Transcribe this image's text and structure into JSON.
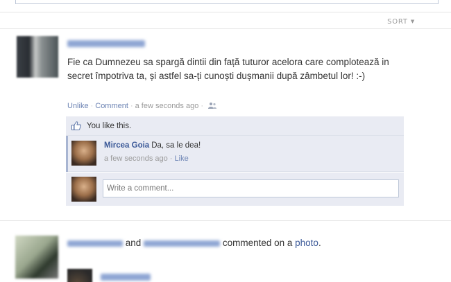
{
  "sort": {
    "label": "SORT"
  },
  "post": {
    "text": "Fie ca Dumnezeu sa spargă dintii din față tuturor acelora care complotează in secret împotriva ta, și astfel sa-ți cunoști dușmanii după zâmbetul lor! :-)",
    "actions": {
      "unlike": "Unlike",
      "comment": "Comment",
      "timestamp": "a few seconds ago"
    },
    "likes": {
      "text": "You like this."
    },
    "comments": [
      {
        "author": "Mircea Goia",
        "text": "Da, sa le dea!",
        "timestamp": "a few seconds ago",
        "like": "Like"
      }
    ],
    "write_comment": {
      "placeholder": "Write a comment..."
    }
  },
  "story": {
    "and": "and",
    "verb": "commented on a",
    "object": "photo",
    "end": "."
  },
  "colors": {
    "link": "#3b5998",
    "ufi_background": "#e9ebf3",
    "muted": "#999999"
  }
}
